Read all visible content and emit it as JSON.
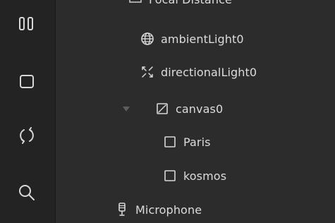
{
  "toolbar": {
    "items": [
      {
        "icon": "pause-icon"
      },
      {
        "icon": "stop-icon"
      },
      {
        "icon": "refresh-icon"
      },
      {
        "icon": "search-icon"
      }
    ]
  },
  "tree": {
    "top_cut_label": "Focal Distance",
    "items": [
      {
        "label": "ambientLight0",
        "icon": "globe-icon"
      },
      {
        "label": "directionalLight0",
        "icon": "directional-light-icon"
      },
      {
        "label": "canvas0",
        "icon": "canvas-icon",
        "expanded": true
      },
      {
        "label": "Paris",
        "icon": "square-icon"
      },
      {
        "label": "kosmos",
        "icon": "square-icon"
      },
      {
        "label": "Microphone",
        "icon": "microphone-icon"
      }
    ]
  }
}
